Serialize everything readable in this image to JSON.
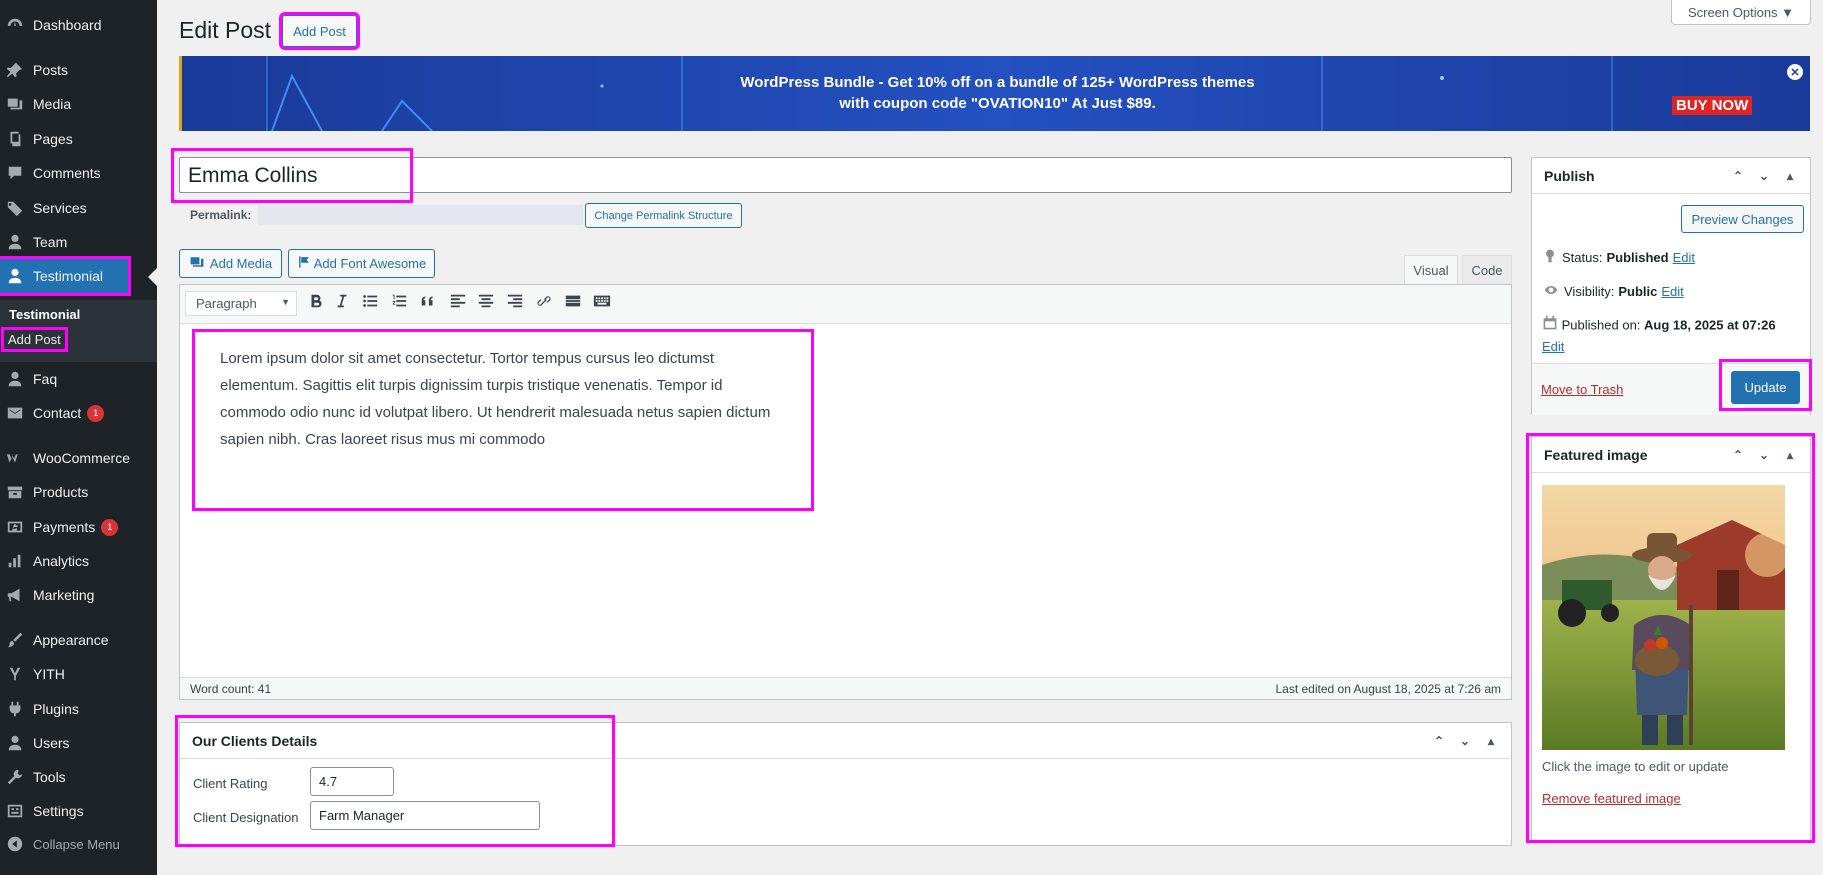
{
  "sidebar": {
    "items": [
      {
        "label": "Dashboard",
        "icon": "dashboard-icon"
      },
      {
        "label": "Posts",
        "icon": "pin-icon"
      },
      {
        "label": "Media",
        "icon": "media-icon"
      },
      {
        "label": "Pages",
        "icon": "pages-icon"
      },
      {
        "label": "Comments",
        "icon": "comment-icon"
      },
      {
        "label": "Services",
        "icon": "tag-icon"
      },
      {
        "label": "Team",
        "icon": "person-icon"
      },
      {
        "label": "Testimonial",
        "icon": "person-icon"
      },
      {
        "label": "Faq",
        "icon": "person-icon"
      },
      {
        "label": "Contact",
        "icon": "mail-icon",
        "badge": "1"
      },
      {
        "label": "WooCommerce",
        "icon": "woo-icon"
      },
      {
        "label": "Products",
        "icon": "archive-icon"
      },
      {
        "label": "Payments",
        "icon": "dollar-icon",
        "badge": "1"
      },
      {
        "label": "Analytics",
        "icon": "bar-chart-icon"
      },
      {
        "label": "Marketing",
        "icon": "megaphone-icon"
      },
      {
        "label": "Appearance",
        "icon": "brush-icon"
      },
      {
        "label": "YITH",
        "icon": "yith-icon"
      },
      {
        "label": "Plugins",
        "icon": "plug-icon"
      },
      {
        "label": "Users",
        "icon": "person-icon"
      },
      {
        "label": "Tools",
        "icon": "wrench-icon"
      },
      {
        "label": "Settings",
        "icon": "settings-icon"
      }
    ],
    "submenu": {
      "heading": "Testimonial",
      "add_post": "Add Post"
    },
    "collapse": "Collapse Menu"
  },
  "header": {
    "title": "Edit Post",
    "add_post": "Add Post",
    "screen_options": "Screen Options ▼"
  },
  "banner": {
    "line1": "WordPress Bundle - Get 10% off on a bundle of 125+ WordPress themes",
    "line2": "with coupon code \"OVATION10\" At Just $89.",
    "cta": "BUY NOW",
    "close": "✕"
  },
  "post": {
    "title": "Emma Collins",
    "permalink_label": "Permalink:",
    "permalink_button": "Change Permalink Structure"
  },
  "editor": {
    "add_media": "Add Media",
    "add_font_awesome": "Add Font Awesome",
    "tab_visual": "Visual",
    "tab_code": "Code",
    "format_select": "Paragraph",
    "content": "Lorem ipsum dolor sit amet consectetur. Tortor tempus cursus leo dictumst elementum. Sagittis elit turpis dignissim turpis tristique venenatis. Tempor id commodo odio nunc id volutpat libero. Ut hendrerit malesuada netus sapien dictum sapien nibh. Cras laoreet risus mus mi commodo",
    "word_count": "Word count: 41",
    "last_edited": "Last edited on August 18, 2025 at 7:26 am"
  },
  "clients": {
    "heading": "Our Clients Details",
    "rating_label": "Client Rating",
    "rating_value": "4.7",
    "designation_label": "Client Designation",
    "designation_value": "Farm Manager"
  },
  "publish": {
    "heading": "Publish",
    "preview": "Preview Changes",
    "status_label": "Status:",
    "status_value": "Published",
    "visibility_label": "Visibility:",
    "visibility_value": "Public",
    "published_label": "Published on:",
    "published_value": "Aug 18, 2025 at 07:26",
    "edit": "Edit",
    "trash": "Move to Trash",
    "update": "Update"
  },
  "featured": {
    "heading": "Featured image",
    "hint": "Click the image to edit or update",
    "remove": "Remove featured image"
  },
  "colors": {
    "highlight": "#ff00ff",
    "admin_bg": "#1d2327",
    "accent": "#2271b1",
    "banner_bg": "#1a3a9a",
    "badge": "#d63638"
  }
}
